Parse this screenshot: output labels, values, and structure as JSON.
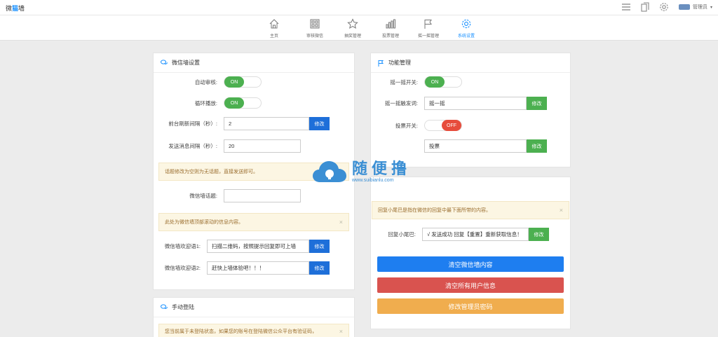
{
  "app": {
    "logo_prefix": "微",
    "logo_highlight": "猫",
    "logo_suffix": "墙",
    "admin_label": "管理员",
    "icons": [
      "list-icon",
      "copy-icon",
      "gear-icon"
    ]
  },
  "nav": {
    "items": [
      {
        "label": "主页",
        "icon": "home-icon"
      },
      {
        "label": "审核微信",
        "icon": "qr-icon"
      },
      {
        "label": "抽奖管理",
        "icon": "star-icon"
      },
      {
        "label": "投票管理",
        "icon": "bar-chart-icon"
      },
      {
        "label": "摇一摇管理",
        "icon": "flag-icon"
      },
      {
        "label": "系统设置",
        "icon": "gear-icon"
      }
    ],
    "active_index": 5
  },
  "wall_settings": {
    "title": "微信墙设置",
    "auto_review_label": "自动审核:",
    "auto_review_value": "ON",
    "loop_label": "循环播放:",
    "loop_value": "ON",
    "refresh_label": "前台刷新间隔（秒）:",
    "refresh_value": "2",
    "refresh_btn": "修改",
    "send_label": "发送消息间隔（秒）:",
    "send_value": "20",
    "topic_note": "话题修改为空则为无话题，直接发送即可。",
    "topic_label": "微信墙话题:",
    "topic_value": "",
    "bottom_note": "此处为微信墙顶部滚动的信息内容。",
    "welcome1_label": "微信墙欢迎语1:",
    "welcome1_value": "扫描二维码，按照提示回复即可上墙",
    "welcome1_btn": "修改",
    "welcome2_label": "微信墙欢迎语2:",
    "welcome2_value": "赶快上墙体验吧！！！",
    "welcome2_btn": "修改"
  },
  "manual_login": {
    "title": "手动登陆",
    "note": "您当前属于未登陆状态，如果您的账号在登陆微信公众平台有验证码，"
  },
  "functions": {
    "title": "功能管理",
    "shake_label": "摇一摇开关:",
    "shake_value": "ON",
    "shake_word_label": "摇一摇触发词:",
    "shake_word_value": "摇一摇",
    "shake_word_btn": "修改",
    "vote_label": "投票开关:",
    "vote_value": "OFF",
    "vote_word_value": "投票",
    "vote_word_btn": "修改"
  },
  "reply": {
    "note": "回复小尾巴是指在微信的回复中最下面所带的内容。",
    "tail_label": "回复小尾巴:",
    "tail_value": "√ 发送成功  回复【重置】重新获取信息！",
    "tail_btn": "修改",
    "clear_wall": "清空微信墙内容",
    "clear_users": "清空所有用户信息",
    "change_pwd": "修改管理员密码"
  },
  "watermark": {
    "name": "随便撸",
    "url": "www.suibianlu.com"
  },
  "colors": {
    "primary": "#1e6fd9",
    "green": "#4cb050",
    "red": "#d9534f",
    "orange": "#f0ad4e",
    "note_bg": "#fcf6e3"
  }
}
